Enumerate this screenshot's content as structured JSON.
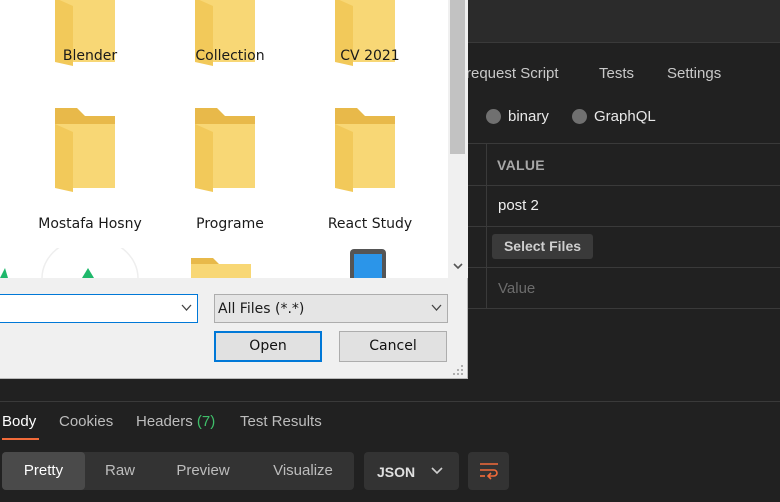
{
  "app": {
    "request_tabs": [
      "request Script",
      "Tests",
      "Settings"
    ],
    "body_types": [
      "binary",
      "GraphQL"
    ],
    "kv_table": {
      "header_value": "VALUE",
      "rows": [
        {
          "value": "post 2"
        },
        {
          "value_button": "Select Files"
        },
        {
          "value_placeholder": "Value"
        }
      ]
    },
    "response_tabs": {
      "body": "Body",
      "cookies": "Cookies",
      "headers": "Headers",
      "headers_count": "(7)",
      "test_results": "Test Results"
    },
    "view_modes": [
      "Pretty",
      "Raw",
      "Preview",
      "Visualize"
    ],
    "format_select": "JSON",
    "colors": {
      "accent": "#f26b3a",
      "count_green": "#3fbf6a",
      "background": "#212121"
    }
  },
  "dialog": {
    "folders": [
      "Blender",
      "Collection",
      "CV 2021",
      "Mostafa Hosny",
      "Programe",
      "React Study"
    ],
    "file_name_value": "",
    "file_type": "All Files (*.*)",
    "open_label": "Open",
    "cancel_label": "Cancel",
    "colors": {
      "folder": "#f8d775",
      "folder_dark": "#e8b94a",
      "focus": "#0078d7"
    }
  }
}
